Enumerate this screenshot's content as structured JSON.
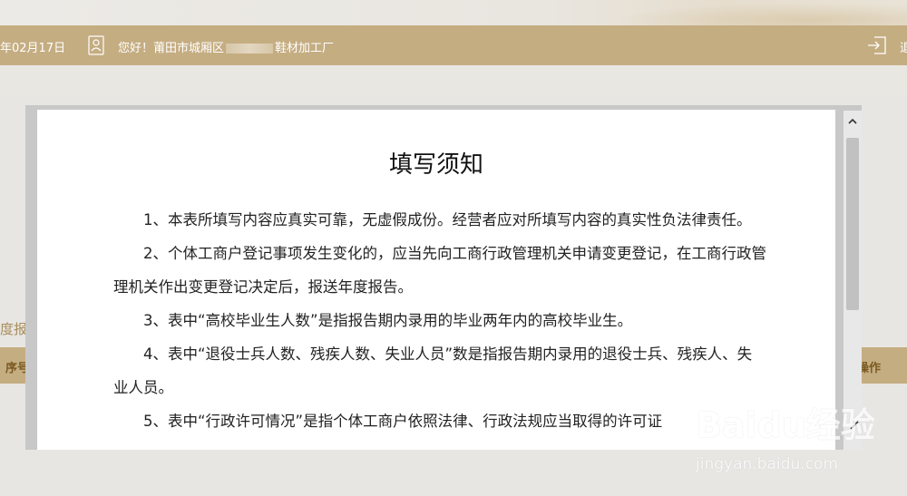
{
  "header": {
    "date": "年02月17日",
    "greeting_prefix": "您好！莆田市城厢区",
    "greeting_suffix": "鞋材加工厂",
    "logout_label": "退"
  },
  "background": {
    "section_title": "度报",
    "table_header": {
      "seq": "序号",
      "operation": "操作"
    }
  },
  "modal": {
    "title": "填写须知",
    "paragraphs": [
      "1、本表所填写内容应真实可靠，无虚假成份。经营者应对所填写内容的真实性负法律责任。",
      "2、个体工商户登记事项发生变化的，应当先向工商行政管理机关申请变更登记，在工商行政管理机关作出变更登记决定后，报送年度报告。",
      "3、表中“高校毕业生人数”是指报告期内录用的毕业两年内的高校毕业生。",
      "4、表中“退役士兵人数、残疾人数、失业人员”数是指报告期内录用的退役士兵、残疾人、失业人员。",
      "5、表中“行政许可情况”是指个体工商户依照法律、行政法规应当取得的许可证"
    ]
  },
  "watermark": {
    "logo": "Baidu经验",
    "url": "jingyan.baidu.com"
  },
  "icons": [
    "user-icon",
    "logout-icon",
    "scroll-up-icon",
    "pencil-icon"
  ],
  "colors": {
    "header_gold": "#c5ad82",
    "background": "#e7e6e3",
    "title_brown": "#a98d5a"
  }
}
